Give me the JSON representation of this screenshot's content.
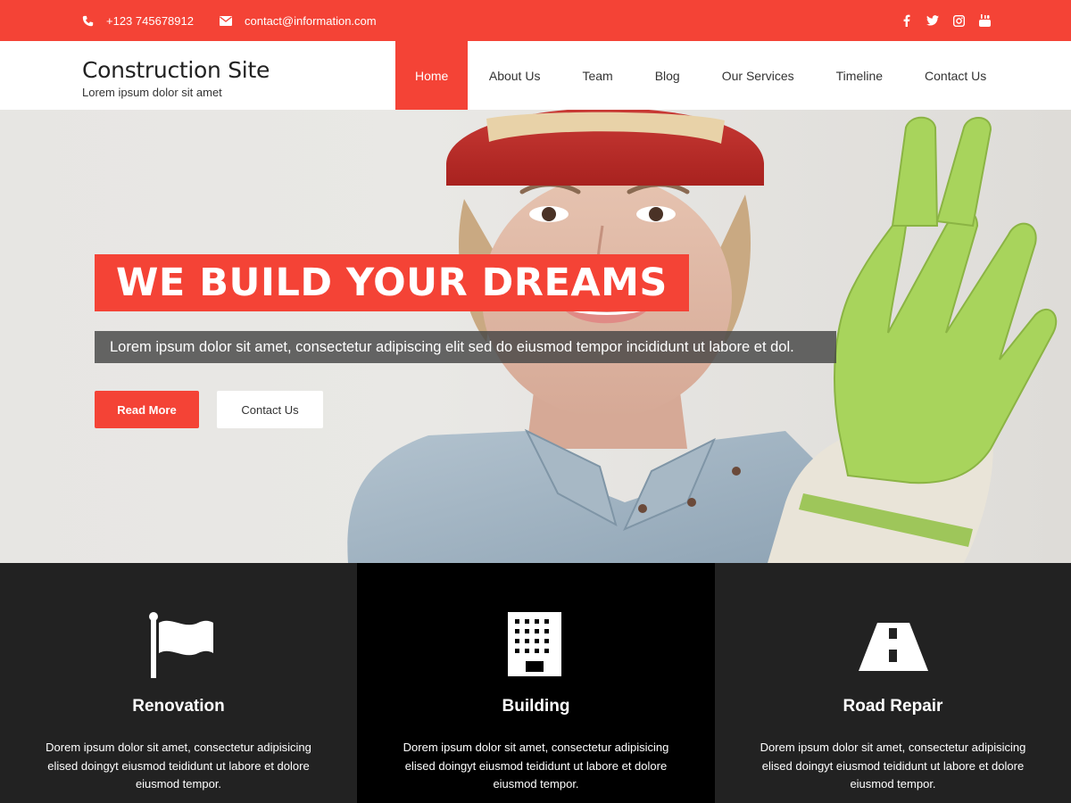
{
  "topbar": {
    "phone": "+123 745678912",
    "email": "contact@information.com",
    "social": [
      "facebook-icon",
      "twitter-icon",
      "instagram-icon",
      "youtube-icon"
    ]
  },
  "header": {
    "site_title": "Construction Site",
    "tagline": "Lorem ipsum dolor sit amet"
  },
  "nav": {
    "items": [
      {
        "label": "Home",
        "active": true
      },
      {
        "label": "About Us"
      },
      {
        "label": "Team"
      },
      {
        "label": "Blog"
      },
      {
        "label": "Our Services"
      },
      {
        "label": "Timeline"
      },
      {
        "label": "Contact Us"
      }
    ]
  },
  "hero": {
    "headline": "WE BUILD YOUR DREAMS",
    "lead": "Lorem ipsum dolor sit amet, consectetur adipiscing elit sed do eiusmod tempor incididunt ut labore et dol.",
    "primary_button": "Read More",
    "secondary_button": "Contact Us"
  },
  "features": [
    {
      "icon": "flag-icon",
      "title": "Renovation",
      "description": "Dorem ipsum dolor sit amet, consectetur adipisicing elised doingyt eiusmod teididunt ut labore et dolore eiusmod tempor."
    },
    {
      "icon": "building-icon",
      "title": "Building",
      "description": "Dorem ipsum dolor sit amet, consectetur adipisicing elised doingyt eiusmod teididunt ut labore et dolore eiusmod tempor."
    },
    {
      "icon": "road-icon",
      "title": "Road Repair",
      "description": "Dorem ipsum dolor sit amet, consectetur adipisicing elised doingyt eiusmod teididunt ut labore et dolore eiusmod tempor."
    }
  ],
  "colors": {
    "accent": "#f44336",
    "dark": "#222222",
    "black": "#000000",
    "glove": "#a8d45c"
  }
}
